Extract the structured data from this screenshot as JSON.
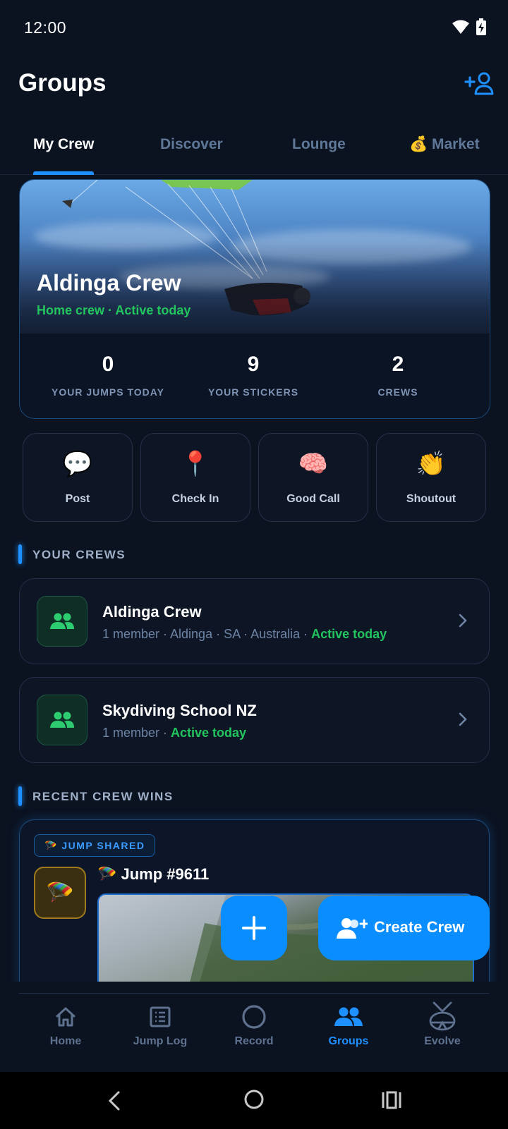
{
  "status_bar": {
    "time": "12:00"
  },
  "header": {
    "title": "Groups"
  },
  "tabs": [
    {
      "label": "My Crew",
      "active": true
    },
    {
      "label": "Discover"
    },
    {
      "label": "Lounge"
    },
    {
      "label": "💰 Market"
    }
  ],
  "hero": {
    "name": "Aldinga Crew",
    "subtitle": "Home crew · Active today",
    "stats": [
      {
        "value": "0",
        "label": "YOUR JUMPS TODAY"
      },
      {
        "value": "9",
        "label": "YOUR STICKERS"
      },
      {
        "value": "2",
        "label": "CREWS"
      }
    ]
  },
  "quick_actions": [
    {
      "emoji": "💬",
      "label": "Post"
    },
    {
      "emoji": "📍",
      "label": "Check In"
    },
    {
      "emoji": "🧠",
      "label": "Good Call"
    },
    {
      "emoji": "👏",
      "label": "Shoutout"
    }
  ],
  "your_crews": {
    "title": "YOUR CREWS",
    "items": [
      {
        "name": "Aldinga Crew",
        "meta": "1 member · Aldinga · SA · Australia · ",
        "activity": "Active today"
      },
      {
        "name": "Skydiving School NZ",
        "meta": "1 member · ",
        "activity": "Active today"
      }
    ]
  },
  "recent_wins": {
    "title": "RECENT CREW WINS",
    "badge": "🪂 JUMP SHARED",
    "icon_emoji": "🪂",
    "win_title": "🪂 Jump #9611"
  },
  "fab": {
    "create_label": "Create Crew"
  },
  "bottom_nav": [
    {
      "label": "Home",
      "icon": "home-icon"
    },
    {
      "label": "Jump Log",
      "icon": "log-icon"
    },
    {
      "label": "Record",
      "icon": "record-icon"
    },
    {
      "label": "Groups",
      "icon": "groups-icon",
      "active": true
    },
    {
      "label": "Evolve",
      "icon": "evolve-icon"
    }
  ],
  "colors": {
    "accent": "#1e90ff",
    "active_green": "#22c55e",
    "background": "#0b1220"
  }
}
